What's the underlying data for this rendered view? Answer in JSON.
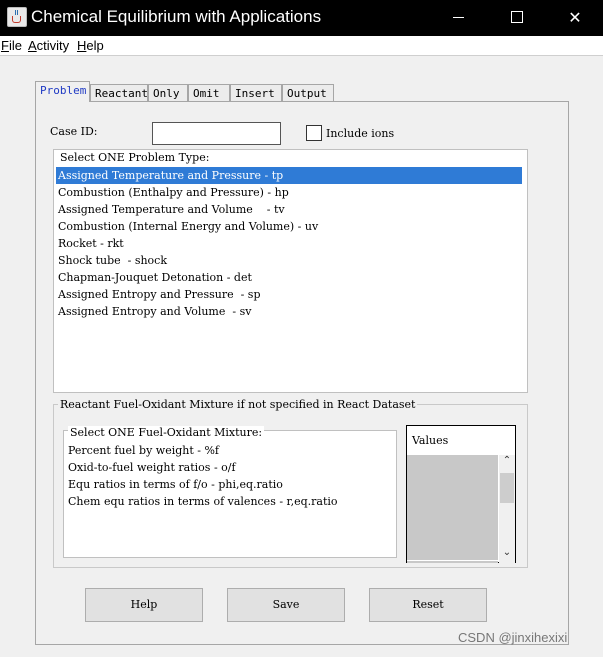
{
  "window": {
    "title": "Chemical Equilibrium with Applications",
    "minimize_label": "",
    "maximize_label": "",
    "close_label": "✕"
  },
  "menu": [
    "File",
    "Activity",
    "Help"
  ],
  "tabs": [
    "Problem",
    "Reactant",
    "Only",
    "Omit",
    "Insert",
    "Output"
  ],
  "case_id": {
    "label": "Case ID:",
    "value": ""
  },
  "include_ions": {
    "label": "Include ions",
    "checked": false
  },
  "problem_type": {
    "title": "Select ONE Problem Type:",
    "items": [
      "Assigned Temperature and Pressure - tp",
      "Combustion (Enthalpy and Pressure) - hp",
      "Assigned Temperature and Volume    - tv",
      "Combustion (Internal Energy and Volume) - uv",
      "Rocket - rkt",
      "Shock tube  - shock",
      "Chapman-Jouquet Detonation - det",
      "Assigned Entropy and Pressure  - sp",
      "Assigned Entropy and Volume  - sv"
    ],
    "selected_index": 0
  },
  "mixture_group": {
    "title": "Reactant Fuel-Oxidant Mixture if not specified in React Dataset",
    "list_title": "Select ONE Fuel-Oxidant Mixture:",
    "items": [
      "Percent fuel by weight - %f",
      "Oxid-to-fuel weight ratios - o/f",
      "Equ ratios in terms of f/o - phi,eq.ratio",
      "Chem equ ratios in terms of valences - r,eq.ratio"
    ],
    "values_header": "Values"
  },
  "buttons": {
    "help": "Help",
    "save": "Save",
    "reset": "Reset"
  },
  "watermark": "CSDN @jinxihexixi",
  "colors": {
    "selection": "#2f7bd6",
    "active_tab_text": "#1f3ac4",
    "titlebar": "#000000"
  },
  "icons": {
    "app": "java-cup-icon",
    "scroll_up": "chevron-up-icon",
    "scroll_down": "chevron-down-icon"
  }
}
